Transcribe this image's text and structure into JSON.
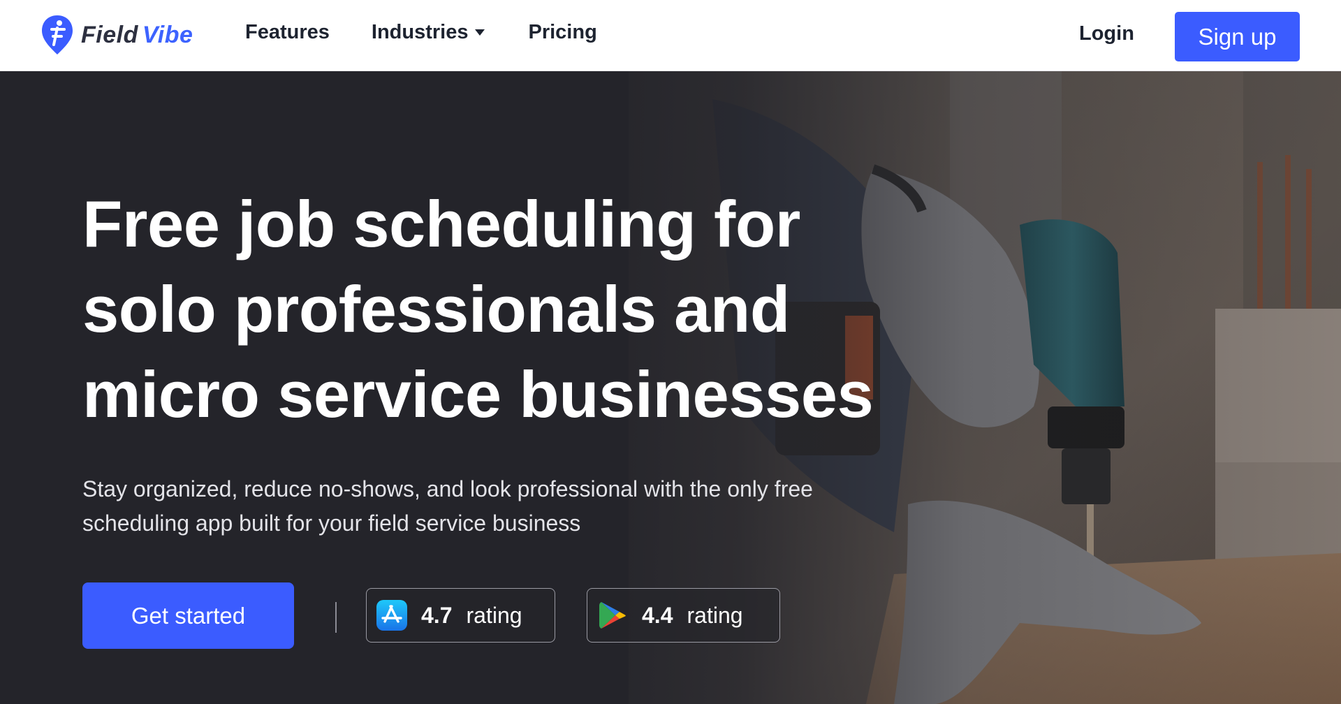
{
  "header": {
    "logo": {
      "word1": "Field",
      "word2": "Vibe",
      "icon": "fieldvibe-pin-logo-icon"
    },
    "nav": {
      "features": "Features",
      "industries": "Industries",
      "pricing": "Pricing"
    },
    "login": "Login",
    "signup": "Sign up"
  },
  "hero": {
    "headline_lines": [
      "Free job scheduling for",
      "solo professionals and",
      "micro service businesses"
    ],
    "subtext_lines": [
      "Stay organized, reduce no-shows, and look professional with the only free",
      "scheduling app built for your field service business"
    ],
    "cta": "Get started",
    "ratings": [
      {
        "store": "App Store",
        "icon": "app-store-icon",
        "value": "4.7",
        "label": "rating"
      },
      {
        "store": "Google Play",
        "icon": "google-play-icon",
        "value": "4.4",
        "label": "rating"
      }
    ],
    "background_image": "worker-with-gloves-drilling-into-wood-beam"
  },
  "colors": {
    "brand_blue": "#3b5cff",
    "hero_background": "#24242a",
    "header_background": "#ffffff",
    "nav_text": "#1d2330"
  }
}
